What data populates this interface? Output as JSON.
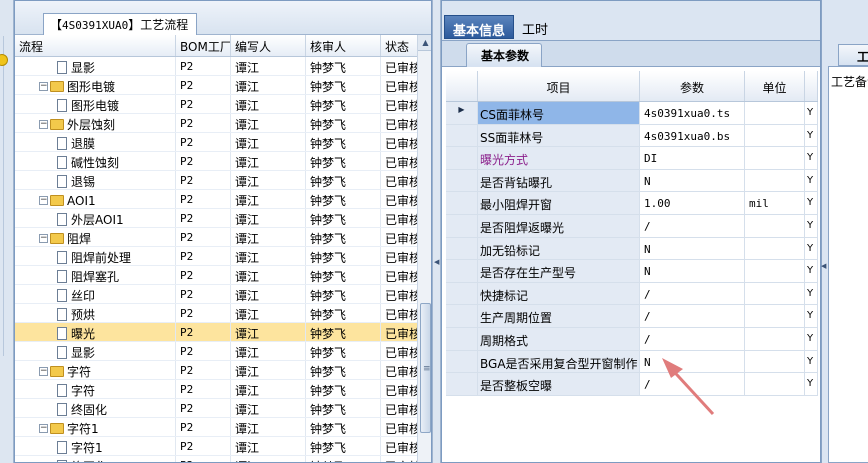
{
  "tree_tab": {
    "prefix": "【",
    "code": "4S0391XUA0",
    "suffix": "】工艺流程"
  },
  "tree_columns": [
    "流程",
    "BOM工厂",
    "编写人",
    "核审人",
    "状态"
  ],
  "tree_rows": [
    {
      "level": 1,
      "kind": "doc",
      "name": "显影",
      "factory": "P2",
      "writer": "谭江",
      "reviewer": "钟梦飞",
      "status": "已审核",
      "selected": false
    },
    {
      "level": 0,
      "kind": "folder",
      "name": "图形电镀",
      "factory": "P2",
      "writer": "谭江",
      "reviewer": "钟梦飞",
      "status": "已审核",
      "selected": false
    },
    {
      "level": 1,
      "kind": "doc",
      "name": "图形电镀",
      "factory": "P2",
      "writer": "谭江",
      "reviewer": "钟梦飞",
      "status": "已审核",
      "selected": false
    },
    {
      "level": 0,
      "kind": "folder",
      "name": "外层蚀刻",
      "factory": "P2",
      "writer": "谭江",
      "reviewer": "钟梦飞",
      "status": "已审核",
      "selected": false
    },
    {
      "level": 1,
      "kind": "doc",
      "name": "退膜",
      "factory": "P2",
      "writer": "谭江",
      "reviewer": "钟梦飞",
      "status": "已审核",
      "selected": false
    },
    {
      "level": 1,
      "kind": "doc",
      "name": "碱性蚀刻",
      "factory": "P2",
      "writer": "谭江",
      "reviewer": "钟梦飞",
      "status": "已审核",
      "selected": false
    },
    {
      "level": 1,
      "kind": "doc",
      "name": "退锡",
      "factory": "P2",
      "writer": "谭江",
      "reviewer": "钟梦飞",
      "status": "已审核",
      "selected": false
    },
    {
      "level": 0,
      "kind": "folder",
      "name": "AOI1",
      "factory": "P2",
      "writer": "谭江",
      "reviewer": "钟梦飞",
      "status": "已审核",
      "selected": false
    },
    {
      "level": 1,
      "kind": "doc",
      "name": "外层AOI1",
      "factory": "P2",
      "writer": "谭江",
      "reviewer": "钟梦飞",
      "status": "已审核",
      "selected": false
    },
    {
      "level": 0,
      "kind": "folder",
      "name": "阻焊",
      "factory": "P2",
      "writer": "谭江",
      "reviewer": "钟梦飞",
      "status": "已审核",
      "selected": false
    },
    {
      "level": 1,
      "kind": "doc",
      "name": "阻焊前处理",
      "factory": "P2",
      "writer": "谭江",
      "reviewer": "钟梦飞",
      "status": "已审核",
      "selected": false
    },
    {
      "level": 1,
      "kind": "doc",
      "name": "阻焊塞孔",
      "factory": "P2",
      "writer": "谭江",
      "reviewer": "钟梦飞",
      "status": "已审核",
      "selected": false
    },
    {
      "level": 1,
      "kind": "doc",
      "name": "丝印",
      "factory": "P2",
      "writer": "谭江",
      "reviewer": "钟梦飞",
      "status": "已审核",
      "selected": false
    },
    {
      "level": 1,
      "kind": "doc",
      "name": "预烘",
      "factory": "P2",
      "writer": "谭江",
      "reviewer": "钟梦飞",
      "status": "已审核",
      "selected": false
    },
    {
      "level": 1,
      "kind": "doc",
      "name": "曝光",
      "factory": "P2",
      "writer": "谭江",
      "reviewer": "钟梦飞",
      "status": "已审核",
      "selected": true
    },
    {
      "level": 1,
      "kind": "doc",
      "name": "显影",
      "factory": "P2",
      "writer": "谭江",
      "reviewer": "钟梦飞",
      "status": "已审核",
      "selected": false
    },
    {
      "level": 0,
      "kind": "folder",
      "name": "字符",
      "factory": "P2",
      "writer": "谭江",
      "reviewer": "钟梦飞",
      "status": "已审核",
      "selected": false
    },
    {
      "level": 1,
      "kind": "doc",
      "name": "字符",
      "factory": "P2",
      "writer": "谭江",
      "reviewer": "钟梦飞",
      "status": "已审核",
      "selected": false
    },
    {
      "level": 1,
      "kind": "doc",
      "name": "终固化",
      "factory": "P2",
      "writer": "谭江",
      "reviewer": "钟梦飞",
      "status": "已审核",
      "selected": false
    },
    {
      "level": 0,
      "kind": "folder",
      "name": "字符1",
      "factory": "P2",
      "writer": "谭江",
      "reviewer": "钟梦飞",
      "status": "已审核",
      "selected": false
    },
    {
      "level": 1,
      "kind": "doc",
      "name": "字符1",
      "factory": "P2",
      "writer": "谭江",
      "reviewer": "钟梦飞",
      "status": "已审核",
      "selected": false
    },
    {
      "level": 1,
      "kind": "doc",
      "name": "终固化",
      "factory": "P2",
      "writer": "谭江",
      "reviewer": "钟梦飞",
      "status": "已审核",
      "selected": false
    }
  ],
  "top_tabs": {
    "basic": "基本信息",
    "hours": "工时"
  },
  "sub_tab": "基本参数",
  "grid_columns": {
    "item": "项目",
    "param": "参数",
    "unit": "单位",
    "flag": ""
  },
  "grid_rows": [
    {
      "current": true,
      "item": "CS面菲林号",
      "param": "4s0391xua0.ts",
      "unit": "",
      "flag": "Y",
      "style": "hl"
    },
    {
      "current": false,
      "item": "SS面菲林号",
      "param": "4s0391xua0.bs",
      "unit": "",
      "flag": "Y",
      "style": ""
    },
    {
      "current": false,
      "item": "曝光方式",
      "param": "DI",
      "unit": "",
      "flag": "Y",
      "style": "purple"
    },
    {
      "current": false,
      "item": "是否背钻曝孔",
      "param": "N",
      "unit": "",
      "flag": "Y",
      "style": ""
    },
    {
      "current": false,
      "item": "最小阻焊开窗",
      "param": "1.00",
      "unit": "mil",
      "flag": "Y",
      "style": ""
    },
    {
      "current": false,
      "item": "是否阻焊返曝光",
      "param": "/",
      "unit": "",
      "flag": "Y",
      "style": ""
    },
    {
      "current": false,
      "item": "加无铅标记",
      "param": "N",
      "unit": "",
      "flag": "Y",
      "style": ""
    },
    {
      "current": false,
      "item": "是否存在生产型号",
      "param": "N",
      "unit": "",
      "flag": "Y",
      "style": ""
    },
    {
      "current": false,
      "item": "快捷标记",
      "param": "/",
      "unit": "",
      "flag": "Y",
      "style": ""
    },
    {
      "current": false,
      "item": "生产周期位置",
      "param": "/",
      "unit": "",
      "flag": "Y",
      "style": ""
    },
    {
      "current": false,
      "item": "周期格式",
      "param": "/",
      "unit": "",
      "flag": "Y",
      "style": ""
    },
    {
      "current": false,
      "item": "BGA是否采用复合型开窗制作",
      "param": "N",
      "unit": "",
      "flag": "Y",
      "style": ""
    },
    {
      "current": false,
      "item": "是否整板空曝",
      "param": "/",
      "unit": "",
      "flag": "Y",
      "style": ""
    }
  ],
  "right_edge": {
    "tab": "工",
    "content": "工艺备注"
  },
  "colors": {
    "selected_row": "#fde49e",
    "highlight_cell": "#8fb6e8",
    "annotation_arrow": "#e07c7c",
    "active_tab": "#2c5a9c"
  }
}
